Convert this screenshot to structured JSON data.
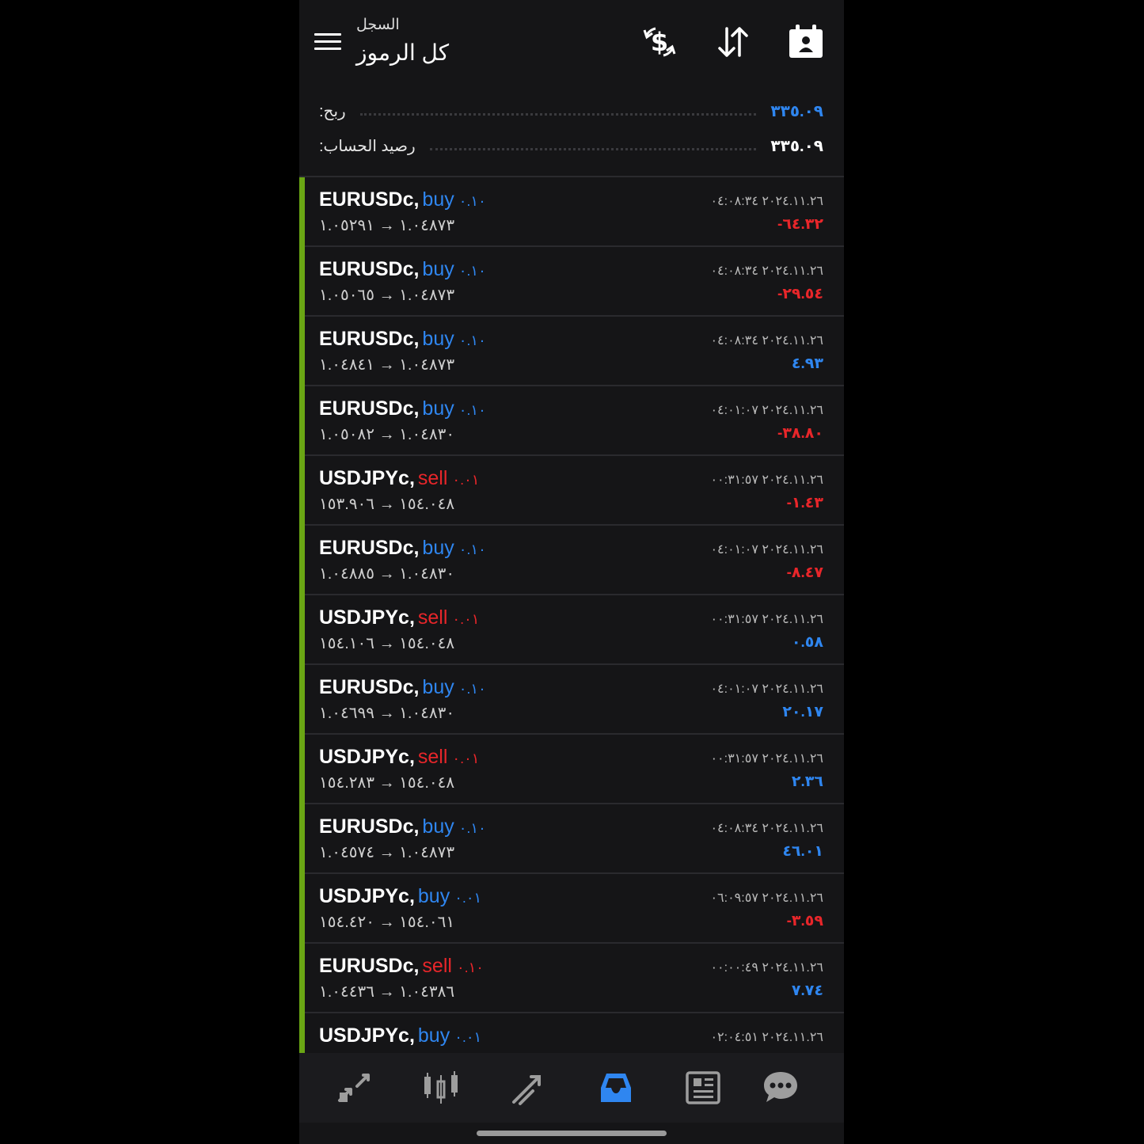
{
  "header": {
    "subtitle": "السجل",
    "title": "كل الرموز",
    "icons": [
      "menu-icon",
      "deposit-icon",
      "sort-icon",
      "calendar-icon"
    ]
  },
  "summary": {
    "profit_label": "ربح:",
    "profit_value": "٣٣٥.٠٩",
    "balance_label": "رصيد الحساب:",
    "balance_value": "٣٣٥.٠٩",
    "colors": {
      "profit": "#2f86f0",
      "balance": "#ffffff"
    }
  },
  "trades": [
    {
      "symbol": "EURUSDc,",
      "direction": "buy",
      "volume": "٠.١٠",
      "prices": "١.٠٤٨٧٣ → ١.٠٥٢٩١",
      "time": "٢٠٢٤.١١.٢٦ ٠٤:٠٨:٣٤",
      "profit": "-٦٤.٣٢",
      "sign": "neg"
    },
    {
      "symbol": "EURUSDc,",
      "direction": "buy",
      "volume": "٠.١٠",
      "prices": "١.٠٤٨٧٣ → ١.٠٥٠٦٥",
      "time": "٢٠٢٤.١١.٢٦ ٠٤:٠٨:٣٤",
      "profit": "-٢٩.٥٤",
      "sign": "neg"
    },
    {
      "symbol": "EURUSDc,",
      "direction": "buy",
      "volume": "٠.١٠",
      "prices": "١.٠٤٨٧٣ → ١.٠٤٨٤١",
      "time": "٢٠٢٤.١١.٢٦ ٠٤:٠٨:٣٤",
      "profit": "٤.٩٣",
      "sign": "pos"
    },
    {
      "symbol": "EURUSDc,",
      "direction": "buy",
      "volume": "٠.١٠",
      "prices": "١.٠٤٨٣٠ → ١.٠٥٠٨٢",
      "time": "٢٠٢٤.١١.٢٦ ٠٤:٠١:٠٧",
      "profit": "-٣٨.٨٠",
      "sign": "neg"
    },
    {
      "symbol": "USDJPYc,",
      "direction": "sell",
      "volume": "٠.٠١",
      "prices": "١٥٤.٠٤٨ → ١٥٣.٩٠٦",
      "time": "٢٠٢٤.١١.٢٦ ٠٠:٣١:٥٧",
      "profit": "-١.٤٣",
      "sign": "neg"
    },
    {
      "symbol": "EURUSDc,",
      "direction": "buy",
      "volume": "٠.١٠",
      "prices": "١.٠٤٨٣٠ → ١.٠٤٨٨٥",
      "time": "٢٠٢٤.١١.٢٦ ٠٤:٠١:٠٧",
      "profit": "-٨.٤٧",
      "sign": "neg"
    },
    {
      "symbol": "USDJPYc,",
      "direction": "sell",
      "volume": "٠.٠١",
      "prices": "١٥٤.٠٤٨ → ١٥٤.١٠٦",
      "time": "٢٠٢٤.١١.٢٦ ٠٠:٣١:٥٧",
      "profit": "٠.٥٨",
      "sign": "pos"
    },
    {
      "symbol": "EURUSDc,",
      "direction": "buy",
      "volume": "٠.١٠",
      "prices": "١.٠٤٨٣٠ → ١.٠٤٦٩٩",
      "time": "٢٠٢٤.١١.٢٦ ٠٤:٠١:٠٧",
      "profit": "٢٠.١٧",
      "sign": "pos"
    },
    {
      "symbol": "USDJPYc,",
      "direction": "sell",
      "volume": "٠.٠١",
      "prices": "١٥٤.٠٤٨ → ١٥٤.٢٨٣",
      "time": "٢٠٢٤.١١.٢٦ ٠٠:٣١:٥٧",
      "profit": "٢.٣٦",
      "sign": "pos"
    },
    {
      "symbol": "EURUSDc,",
      "direction": "buy",
      "volume": "٠.١٠",
      "prices": "١.٠٤٨٧٣ → ١.٠٤٥٧٤",
      "time": "٢٠٢٤.١١.٢٦ ٠٤:٠٨:٣٤",
      "profit": "٤٦.٠١",
      "sign": "pos"
    },
    {
      "symbol": "USDJPYc,",
      "direction": "buy",
      "volume": "٠.٠١",
      "prices": "١٥٤.٠٦١ → ١٥٤.٤٢٠",
      "time": "٢٠٢٤.١١.٢٦ ٠٦:٠٩:٥٧",
      "profit": "-٣.٥٩",
      "sign": "neg"
    },
    {
      "symbol": "EURUSDc,",
      "direction": "sell",
      "volume": "٠.١٠",
      "prices": "١.٠٤٣٨٦ → ١.٠٤٤٣٦",
      "time": "٢٠٢٤.١١.٢٦ ٠٠:٠٠:٤٩",
      "profit": "٧.٧٤",
      "sign": "pos"
    },
    {
      "symbol": "USDJPYc,",
      "direction": "buy",
      "volume": "٠.٠١",
      "prices": "",
      "time": "٢٠٢٤.١١.٢٦ ٠٢:٠٤:٥١",
      "profit": "",
      "sign": "pos"
    }
  ],
  "bottom_nav": [
    {
      "name": "quotes-icon",
      "active": false
    },
    {
      "name": "chart-icon",
      "active": false
    },
    {
      "name": "trade-icon",
      "active": false
    },
    {
      "name": "history-icon",
      "active": true
    },
    {
      "name": "news-icon",
      "active": false
    },
    {
      "name": "chat-icon",
      "active": false
    }
  ],
  "colors": {
    "accent": "#2f86f0",
    "sell": "#e8262a",
    "bar": "#6aa614",
    "background": "#151517"
  }
}
